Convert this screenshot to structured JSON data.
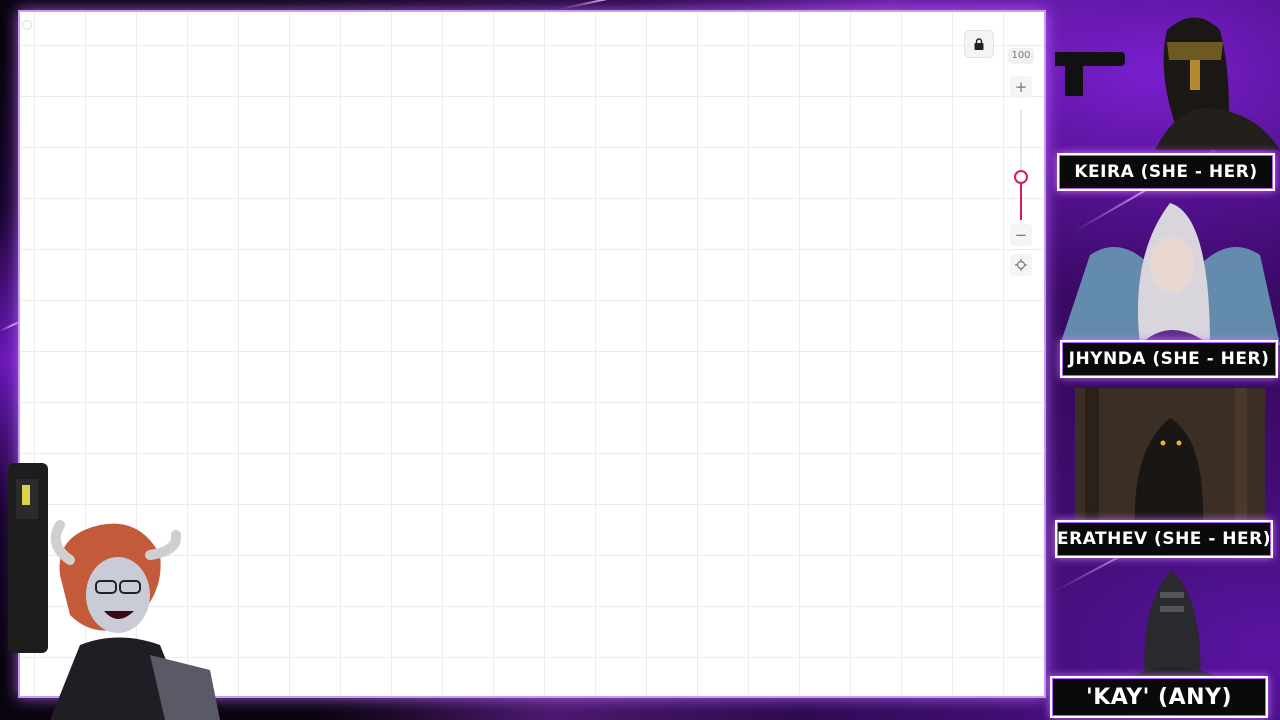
{
  "canvas": {
    "zoom_label": "100",
    "zoom_level_percent": 100,
    "zoom_in_icon": "plus-icon",
    "zoom_out_icon": "minus-icon",
    "recenter_icon": "crosshair-icon",
    "lock_icon": "lock-icon",
    "accent_color": "#d81b60"
  },
  "cams": [
    {
      "name": "KEIRA (SHE - HER)"
    },
    {
      "name": "JHYNDA (SHE - HER)"
    },
    {
      "name": "ERATHEV (SHE - HER)"
    },
    {
      "name": "'KAY' (ANY)"
    }
  ],
  "colors": {
    "overlay_purple": "#7a1fd0",
    "plate_border": "#ffffff",
    "plate_glow": "#b45cff"
  }
}
